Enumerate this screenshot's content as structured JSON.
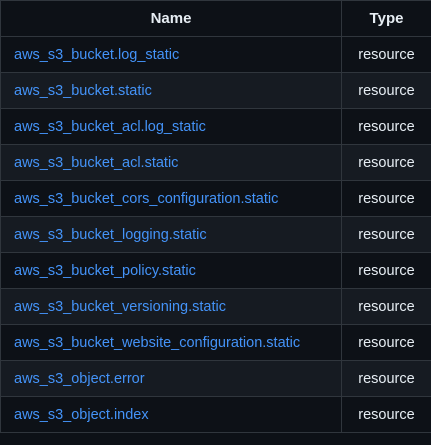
{
  "table": {
    "headers": {
      "name": "Name",
      "type": "Type"
    },
    "rows": [
      {
        "name": "aws_s3_bucket.log_static",
        "type": "resource"
      },
      {
        "name": "aws_s3_bucket.static",
        "type": "resource"
      },
      {
        "name": "aws_s3_bucket_acl.log_static",
        "type": "resource"
      },
      {
        "name": "aws_s3_bucket_acl.static",
        "type": "resource"
      },
      {
        "name": "aws_s3_bucket_cors_configuration.static",
        "type": "resource"
      },
      {
        "name": "aws_s3_bucket_logging.static",
        "type": "resource"
      },
      {
        "name": "aws_s3_bucket_policy.static",
        "type": "resource"
      },
      {
        "name": "aws_s3_bucket_versioning.static",
        "type": "resource"
      },
      {
        "name": "aws_s3_bucket_website_configuration.static",
        "type": "resource"
      },
      {
        "name": "aws_s3_object.error",
        "type": "resource"
      },
      {
        "name": "aws_s3_object.index",
        "type": "resource"
      }
    ]
  },
  "colors": {
    "background": "#0d1117",
    "row_alt": "#161b22",
    "border": "#30363d",
    "link": "#4493f8",
    "text": "#e6edf3"
  }
}
